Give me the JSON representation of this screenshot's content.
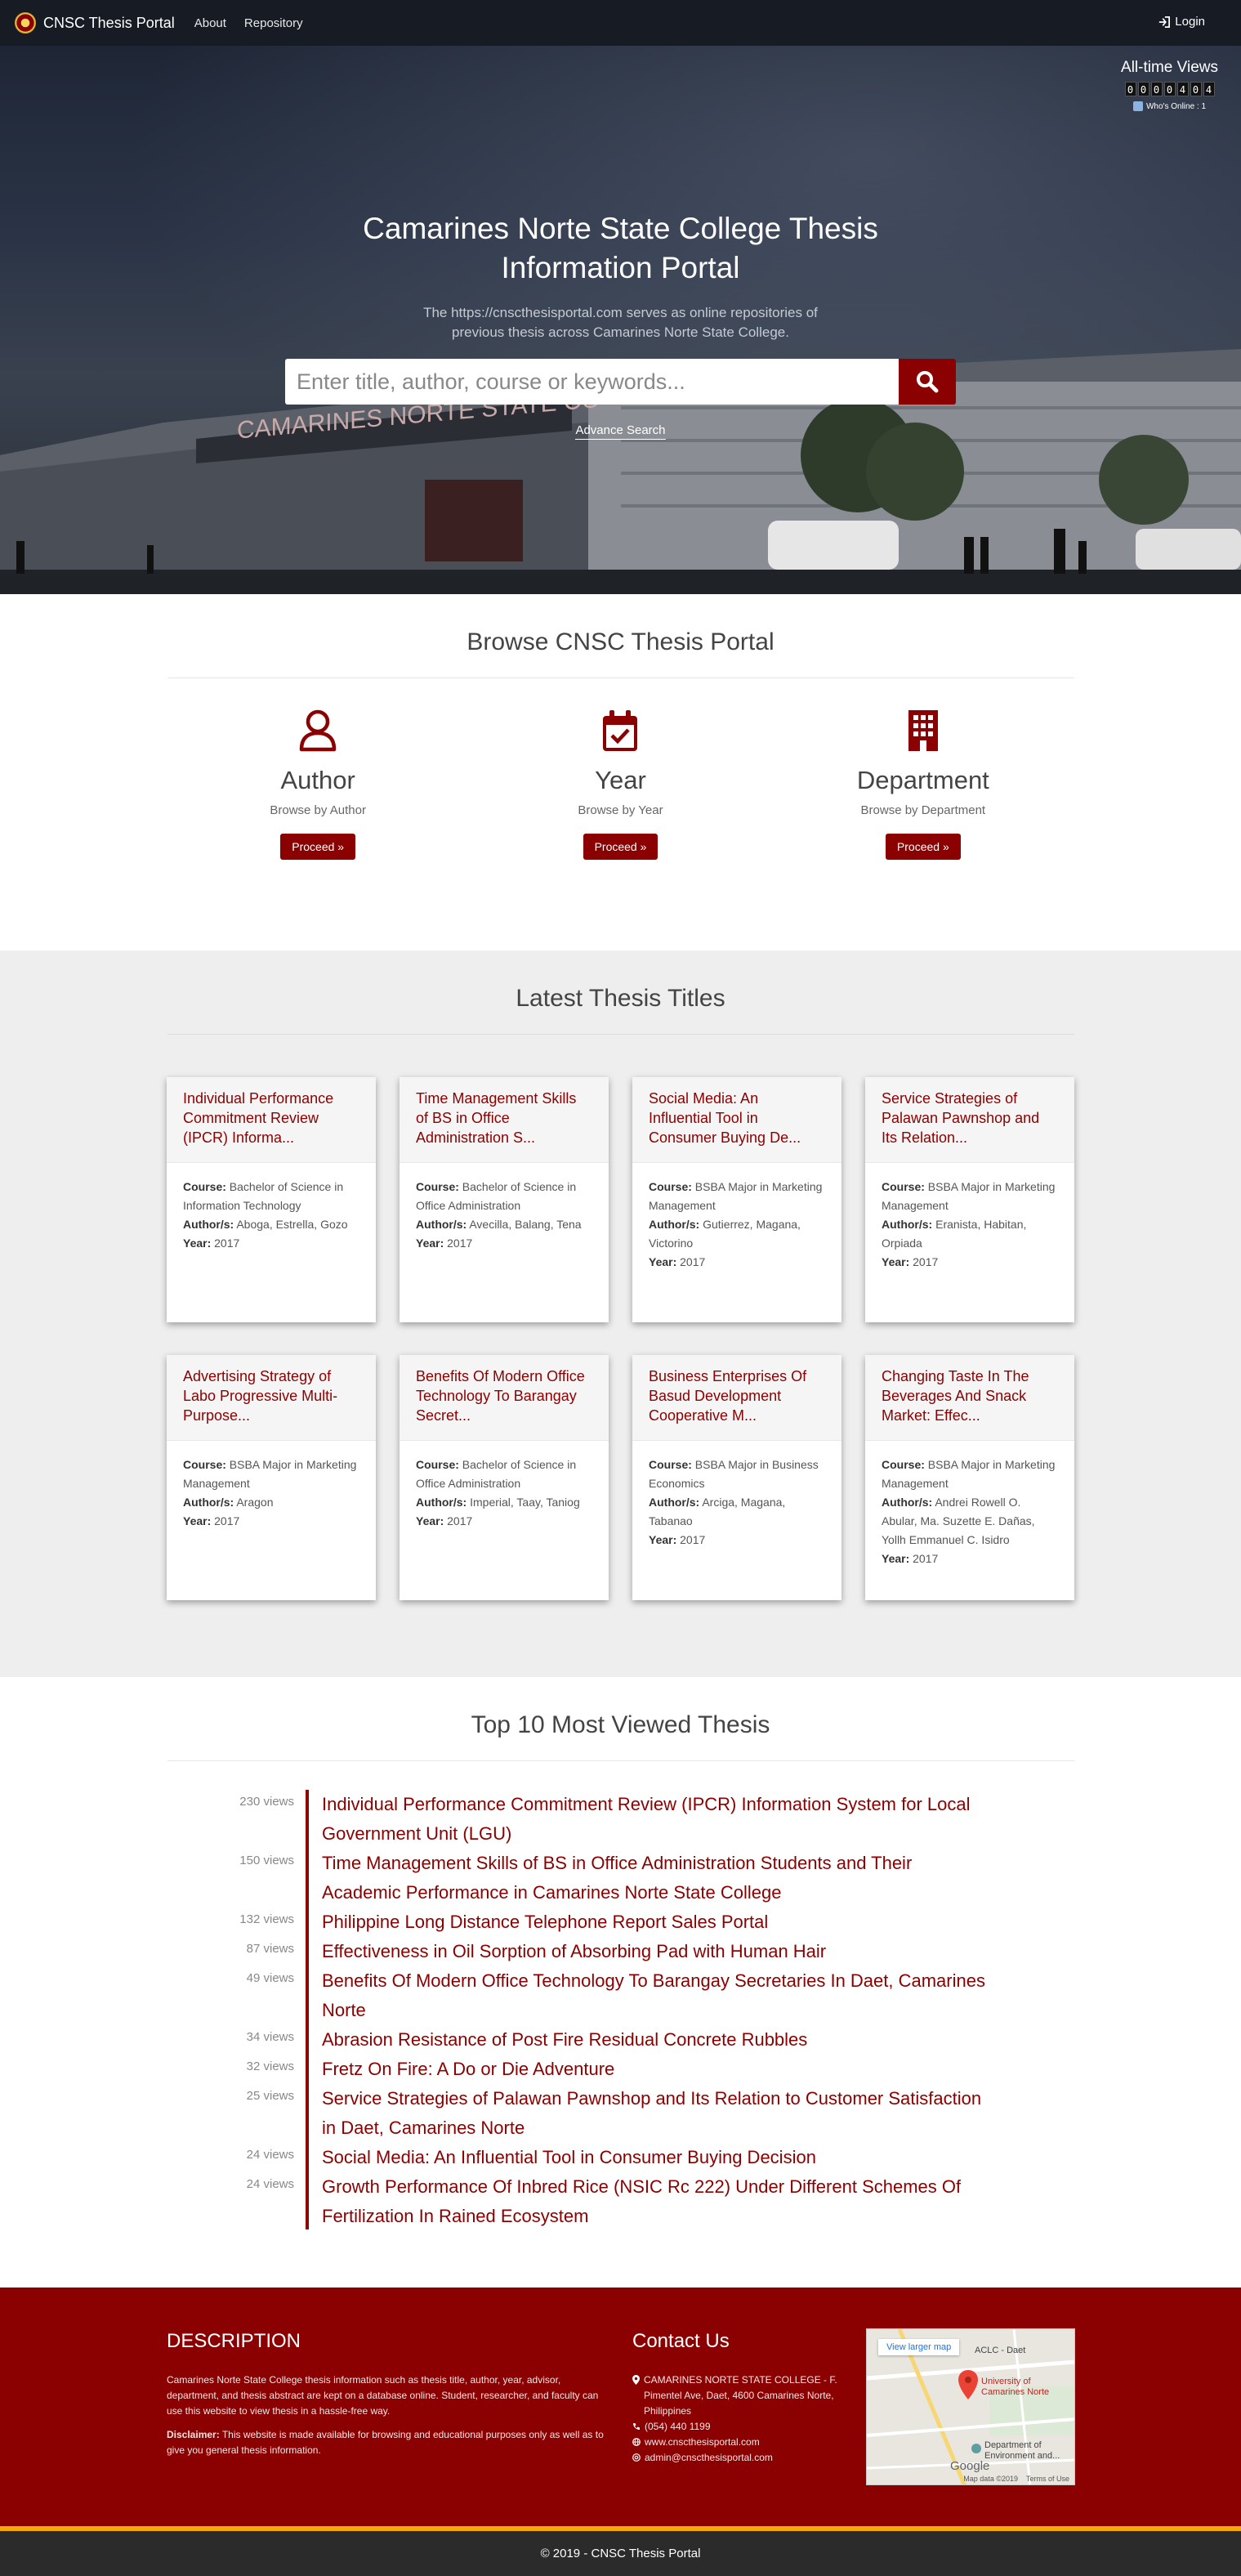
{
  "nav": {
    "brand": "CNSC Thesis Portal",
    "links": [
      "About",
      "Repository"
    ],
    "login": "Login"
  },
  "hero": {
    "counter_title": "All-time Views",
    "counter_digits": [
      "0",
      "0",
      "0",
      "0",
      "4",
      "0",
      "4"
    ],
    "online_text": "Who's Online : 1",
    "title": "Camarines Norte State College Thesis Information Portal",
    "subtitle": "The https://cnscthesisportal.com serves as online repositories of previous thesis across Camarines Norte State College.",
    "search_placeholder": "Enter title, author, course or keywords...",
    "advance_search": "Advance Search",
    "building_sign": "CAMARINES NORTE STATE CO"
  },
  "browse": {
    "title": "Browse CNSC Thesis Portal",
    "items": [
      {
        "name": "Author",
        "sub": "Browse by Author",
        "button": "Proceed »"
      },
      {
        "name": "Year",
        "sub": "Browse by Year",
        "button": "Proceed »"
      },
      {
        "name": "Department",
        "sub": "Browse by Department",
        "button": "Proceed »"
      }
    ]
  },
  "latest": {
    "title": "Latest Thesis Titles",
    "labels": {
      "course": "Course:",
      "authors": "Author/s:",
      "year": "Year:"
    },
    "cards": [
      {
        "title": "Individual Performance Commitment Review (IPCR) Informa...",
        "course": "Bachelor of Science in Information Technology",
        "authors": "Aboga, Estrella, Gozo",
        "year": "2017"
      },
      {
        "title": "Time Management Skills of BS in Office Administration S...",
        "course": "Bachelor of Science in Office Administration",
        "authors": "Avecilla, Balang, Tena",
        "year": "2017"
      },
      {
        "title": "Social Media: An Influential Tool in Consumer Buying De...",
        "course": "BSBA Major in Marketing Management",
        "authors": "Gutierrez, Magana, Victorino",
        "year": "2017"
      },
      {
        "title": "Service Strategies of Palawan Pawnshop and Its Relation...",
        "course": "BSBA Major in Marketing Management",
        "authors": "Eranista, Habitan, Orpiada",
        "year": "2017"
      },
      {
        "title": "Advertising Strategy of Labo Progressive Multi-Purpose...",
        "course": "BSBA Major in Marketing Management",
        "authors": "Aragon",
        "year": "2017"
      },
      {
        "title": "Benefits Of Modern Office Technology To Barangay Secret...",
        "course": "Bachelor of Science in Office Administration",
        "authors": "Imperial, Taay, Taniog",
        "year": "2017"
      },
      {
        "title": "Business Enterprises Of Basud Development Cooperative M...",
        "course": "BSBA Major in Business Economics",
        "authors": "Arciga, Magana, Tabanao",
        "year": "2017"
      },
      {
        "title": "Changing Taste In The Beverages And Snack Market: Effec...",
        "course": "BSBA Major in Marketing Management",
        "authors": "Andrei Rowell O. Abular, Ma. Suzette E. Dañas, Yollh Emmanuel C. Isidro",
        "year": "2017"
      }
    ]
  },
  "top10": {
    "title": "Top 10 Most Viewed Thesis",
    "items": [
      {
        "views": "230 views",
        "title": "Individual Performance Commitment Review (IPCR) Information System for Local Government Unit (LGU)"
      },
      {
        "views": "150 views",
        "title": "Time Management Skills of BS in Office Administration Students and Their Academic Performance in Camarines Norte State College"
      },
      {
        "views": "132 views",
        "title": "Philippine Long Distance Telephone Report Sales Portal"
      },
      {
        "views": "87 views",
        "title": "Effectiveness in Oil Sorption of Absorbing Pad with Human Hair"
      },
      {
        "views": "49 views",
        "title": "Benefits Of Modern Office Technology To Barangay Secretaries In Daet, Camarines Norte"
      },
      {
        "views": "34 views",
        "title": "Abrasion Resistance of Post Fire Residual Concrete Rubbles"
      },
      {
        "views": "32 views",
        "title": "Fretz On Fire: A Do or Die Adventure"
      },
      {
        "views": "25 views",
        "title": "Service Strategies of Palawan Pawnshop and Its Relation to Customer Satisfaction in Daet, Camarines Norte"
      },
      {
        "views": "24 views",
        "title": "Social Media: An Influential Tool in Consumer Buying Decision"
      },
      {
        "views": "24 views",
        "title": "Growth Performance Of Inbred Rice (NSIC Rc 222) Under Different Schemes Of Fertilization In Rained Ecosystem"
      }
    ]
  },
  "footer": {
    "desc_title": "DESCRIPTION",
    "desc_text": "Camarines Norte State College thesis information such as thesis title, author, year, advisor, department, and thesis abstract are kept on a database online. Student, researcher, and faculty can use this website to view thesis in a hassle-free way.",
    "disclaimer_label": "Disclaimer:",
    "disclaimer_text": " This website is made available for browsing and educational purposes only as well as to give you general thesis information.",
    "contact_title": "Contact Us",
    "address": "CAMARINES NORTE STATE COLLEGE - F. Pimentel Ave, Daet, 4600 Camarines Norte, Philippines",
    "phone": "(054) 440 1199",
    "website": "www.cnscthesisportal.com",
    "email": "admin@cnscthesisportal.com",
    "map": {
      "button": "View larger map",
      "label_top": "ACLC - Daet",
      "label_school": "University of Camarines Norte",
      "label_dept": "Department of Environment and...",
      "google": "Google",
      "data": "Map data ©2019",
      "terms": "Terms of Use"
    },
    "copyright": "© 2019 - CNSC Thesis Portal"
  },
  "colors": {
    "brand": "#8b0000",
    "navbar": "#171b24",
    "accent_bar": "#f2a900",
    "bottom_bar": "#2b2b2b"
  }
}
